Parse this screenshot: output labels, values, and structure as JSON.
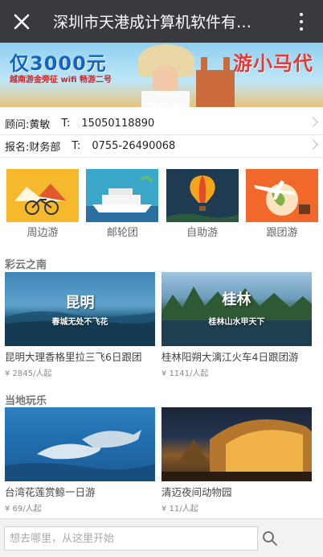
{
  "header": {
    "title": "深圳市天港成计算机软件有…",
    "close_icon": "close-icon",
    "more_icon": "more-vertical-icon"
  },
  "banner": {
    "headline": "仅3000元",
    "tagline": "游小马代",
    "sub": "越南游金旁征 wifi 畅游二号"
  },
  "contacts": [
    {
      "label": "顾问:",
      "name": "黄敏",
      "tlabel": "T:",
      "phone": "15050118890"
    },
    {
      "label": "报名:",
      "name": "财务部",
      "tlabel": "T:",
      "phone": "0755-26490068"
    }
  ],
  "categories": [
    {
      "label": "周边游",
      "icon": "bicycle-icon"
    },
    {
      "label": "邮轮团",
      "icon": "cruise-ship-icon"
    },
    {
      "label": "自助游",
      "icon": "hot-air-balloon-icon"
    },
    {
      "label": "跟团游",
      "icon": "airplane-globe-icon"
    }
  ],
  "sections": [
    {
      "title": "彩云之南",
      "items": [
        {
          "name": "昆明大理香格里拉三飞6日跟团",
          "price": "¥ 2845/人起",
          "cap_big": "昆明",
          "cap_small": "春城无处不飞花"
        },
        {
          "name": "桂林阳朔大漓江火车4日跟团游",
          "price": "¥ 1141/人起",
          "cap_big": "桂林",
          "cap_small": "桂林山水甲天下"
        }
      ]
    },
    {
      "title": "当地玩乐",
      "items": [
        {
          "name": "台湾花莲赏鲸一日游",
          "price": "¥ 69/人起"
        },
        {
          "name": "清迈夜间动物园",
          "price": "¥ 11/人起"
        }
      ]
    }
  ],
  "search": {
    "placeholder": "想去哪里，从这里开始",
    "icon": "search-icon"
  }
}
